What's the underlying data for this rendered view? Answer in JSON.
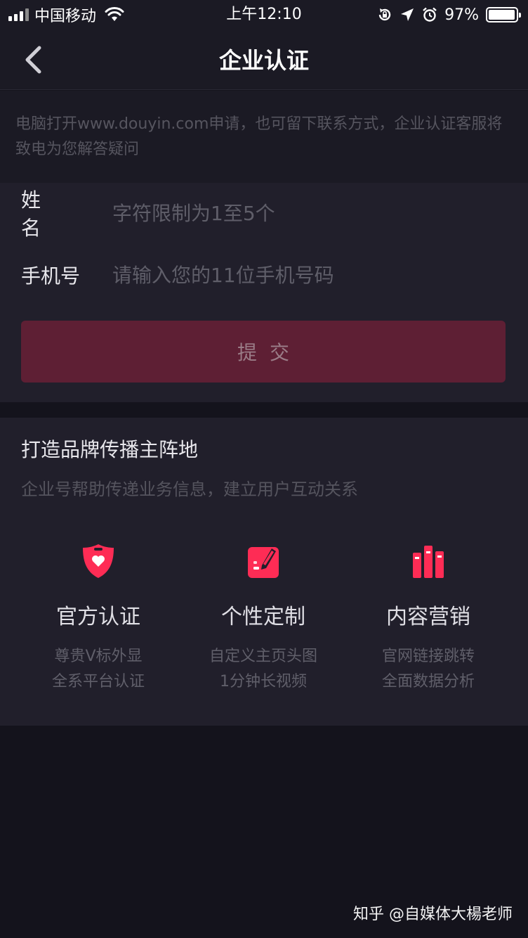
{
  "status_bar": {
    "carrier": "中国移动",
    "time": "上午12:10",
    "battery": "97%",
    "battery_level": 0.97
  },
  "nav": {
    "title": "企业认证"
  },
  "notice": {
    "text": "电脑打开www.douyin.com申请，也可留下联系方式，企业认证客服将致电为您解答疑问"
  },
  "form": {
    "name_label": "姓名",
    "name_placeholder": "字符限制为1至5个",
    "phone_label": "手机号",
    "phone_placeholder": "请输入您的11位手机号码",
    "submit_label": "提交"
  },
  "features": {
    "title": "打造品牌传播主阵地",
    "subtitle": "企业号帮助传递业务信息，建立用户互动关系",
    "items": [
      {
        "icon": "shield-heart-icon",
        "name": "官方认证",
        "desc1": "尊贵V标外显",
        "desc2": "全系平台认证"
      },
      {
        "icon": "edit-note-icon",
        "name": "个性定制",
        "desc1": "自定义主页头图",
        "desc2": "1分钟长视频"
      },
      {
        "icon": "bar-chart-icon",
        "name": "内容营销",
        "desc1": "官网链接跳转",
        "desc2": "全面数据分析"
      }
    ]
  },
  "watermark": "知乎 @自媒体大楊老师",
  "colors": {
    "accent": "#fe2c55",
    "submit_bg": "#5e1f34",
    "background": "#14131c"
  }
}
